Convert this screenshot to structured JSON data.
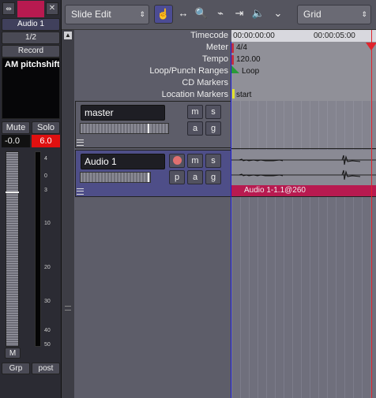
{
  "strip": {
    "track_name": "Audio 1",
    "input": "1/2",
    "record_label": "Record",
    "plugin": "AM pitchshifte",
    "mute_label": "Mute",
    "solo_label": "Solo",
    "gain": "-0.0",
    "peak": "6.0",
    "meter_btn": "M",
    "group_label": "Grp",
    "post_label": "post",
    "scale": [
      "4",
      "0",
      "3",
      "10",
      "20",
      "30",
      "40",
      "50"
    ]
  },
  "toolbar": {
    "edit_mode": "Slide Edit",
    "snap_mode": "Grid"
  },
  "rulers": {
    "timecode_label": "Timecode",
    "timecode_values": [
      "00:00:00:00",
      "00:00:05:00"
    ],
    "meter_label": "Meter",
    "meter_value": "4/4",
    "tempo_label": "Tempo",
    "tempo_value": "120.00",
    "loop_label": "Loop/Punch Ranges",
    "loop_value": "Loop",
    "cd_label": "CD Markers",
    "location_label": "Location Markers",
    "location_value": "start"
  },
  "tracks": {
    "master_name": "master",
    "audio_name": "Audio 1",
    "m": "m",
    "s": "s",
    "a": "a",
    "g": "g",
    "p": "p"
  },
  "region": {
    "label": "Audio 1-1.1@260"
  },
  "colors": {
    "accent": "#b81a50",
    "selected_track": "#4e4e88",
    "playhead": "#e0242c",
    "edit_point": "#1c1cd8"
  }
}
